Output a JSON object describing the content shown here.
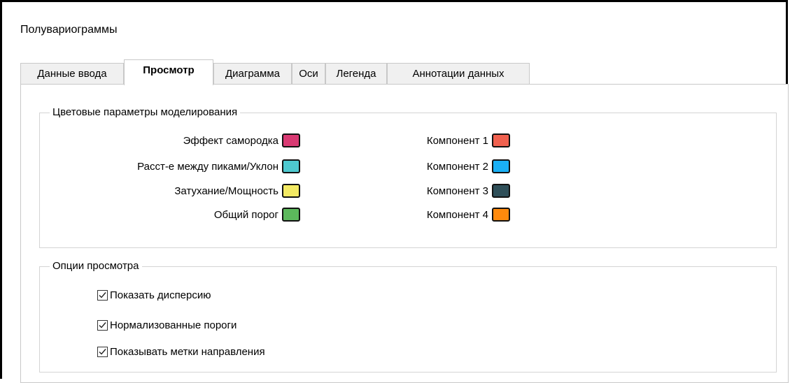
{
  "window": {
    "title": "Полувариограммы"
  },
  "tabs": [
    {
      "label": "Данные ввода",
      "active": false
    },
    {
      "label": "Просмотр",
      "active": true
    },
    {
      "label": "Диаграмма",
      "active": false
    },
    {
      "label": "Оси",
      "active": false
    },
    {
      "label": "Легенда",
      "active": false
    },
    {
      "label": "Аннотации данных",
      "active": false
    }
  ],
  "color_group": {
    "label": "Цветовые параметры моделирования",
    "left": [
      {
        "label": "Эффект самородка",
        "color": "#d93a73"
      },
      {
        "label": "Расст-е между пиками/Уклон",
        "color": "#4ec9cf"
      },
      {
        "label": "Затухание/Мощность",
        "color": "#f3ea64"
      },
      {
        "label": "Общий порог",
        "color": "#5cb85c"
      }
    ],
    "right": [
      {
        "label": "Компонент 1",
        "color": "#f0614f"
      },
      {
        "label": "Компонент 2",
        "color": "#1ab0f5"
      },
      {
        "label": "Компонент 3",
        "color": "#2f4f59"
      },
      {
        "label": "Компонент 4",
        "color": "#ff8a0d"
      }
    ]
  },
  "view_group": {
    "label": "Опции просмотра",
    "options": [
      {
        "label": "Показать дисперсию",
        "checked": true
      },
      {
        "label": "Нормализованные пороги",
        "checked": true
      },
      {
        "label": "Показывать метки направления",
        "checked": true
      }
    ]
  }
}
